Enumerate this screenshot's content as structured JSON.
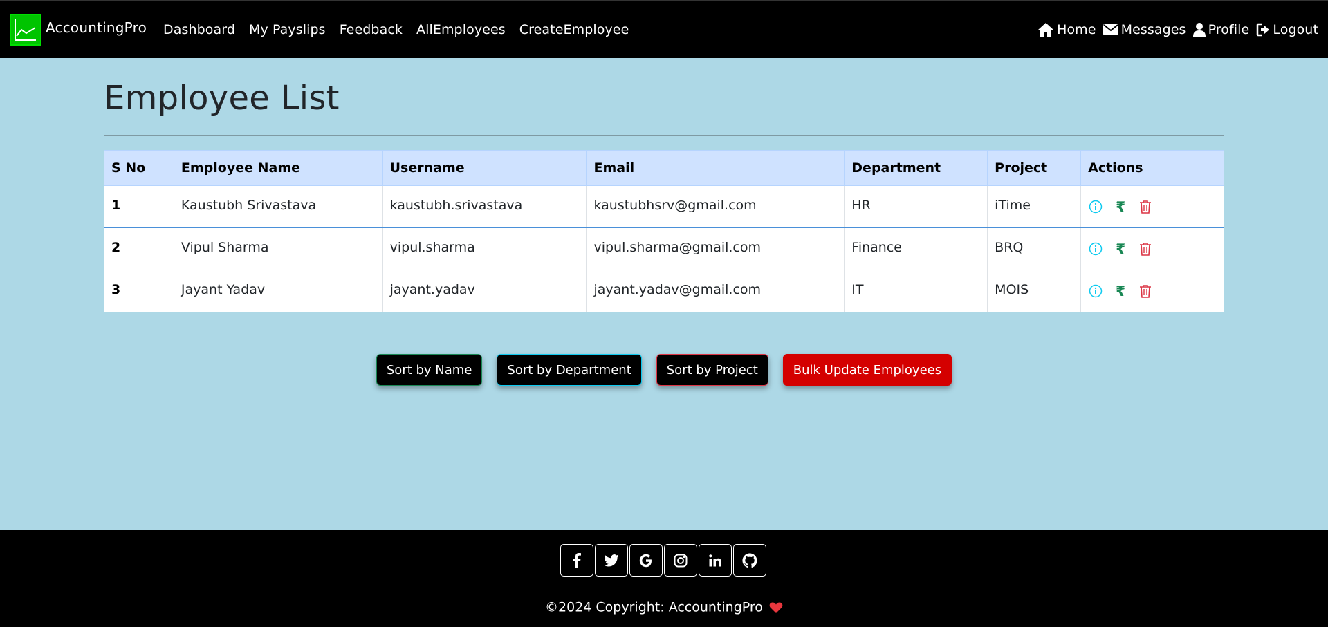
{
  "nav": {
    "brand": "AccountingPro",
    "links": [
      "Dashboard",
      "My Payslips",
      "Feedback",
      "AllEmployees",
      "CreateEmployee"
    ],
    "right": {
      "home": "Home",
      "messages": "Messages",
      "profile": "Profile",
      "logout": "Logout"
    }
  },
  "page": {
    "title": "Employee List"
  },
  "table": {
    "headers": [
      "S No",
      "Employee Name",
      "Username",
      "Email",
      "Department",
      "Project",
      "Actions"
    ],
    "rows": [
      {
        "sno": "1",
        "name": "Kaustubh Srivastava",
        "username": "kaustubh.srivastava",
        "email": "kaustubhsrv@gmail.com",
        "department": "HR",
        "project": "iTime"
      },
      {
        "sno": "2",
        "name": "Vipul Sharma",
        "username": "vipul.sharma",
        "email": "vipul.sharma@gmail.com",
        "department": "Finance",
        "project": "BRQ"
      },
      {
        "sno": "3",
        "name": "Jayant Yadav",
        "username": "jayant.yadav",
        "email": "jayant.yadav@gmail.com",
        "department": "IT",
        "project": "MOIS"
      }
    ],
    "action_icons": [
      "info-icon",
      "rupee-icon",
      "trash-icon"
    ]
  },
  "buttons": {
    "sort_name": "Sort by Name",
    "sort_department": "Sort by Department",
    "sort_project": "Sort by Project",
    "bulk_update": "Bulk Update Employees"
  },
  "footer": {
    "social_icons": [
      "facebook-icon",
      "twitter-icon",
      "google-icon",
      "instagram-icon",
      "linkedin-icon",
      "github-icon"
    ],
    "copyright": "©2024 Copyright: AccountingPro"
  },
  "colors": {
    "background": "#add8e6",
    "navbar": "#000000",
    "table_header": "#cfe2ff",
    "bulk_button": "#d40000",
    "info": "#0dcaf0",
    "rupee": "#198754",
    "trash": "#dc3545",
    "logo": "#00c400"
  }
}
